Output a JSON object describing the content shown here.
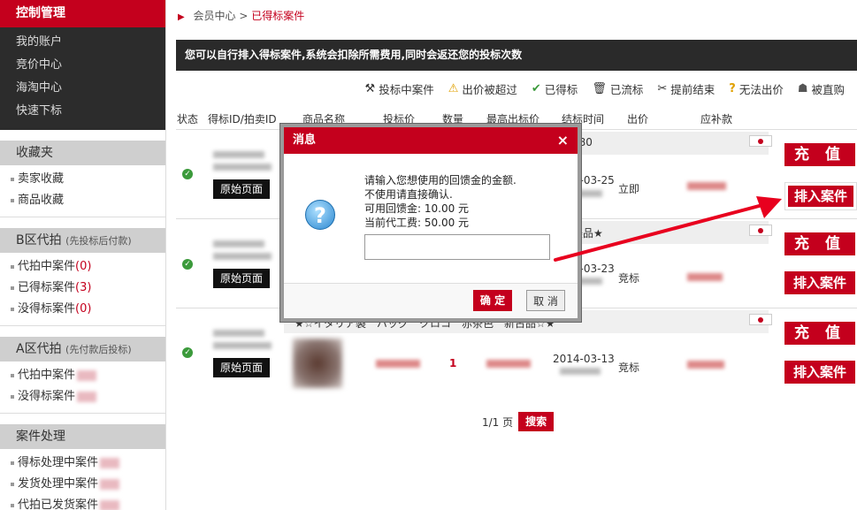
{
  "sidebar": {
    "control_title": "控制管理",
    "control_items": [
      "我的账户",
      "竞价中心",
      "海淘中心",
      "快速下标"
    ],
    "fav_title": "收藏夹",
    "fav_items": [
      "卖家收藏",
      "商品收藏"
    ],
    "b_title": "B区代拍",
    "b_sub": "(先投标后付款)",
    "b_items": [
      {
        "label": "代拍中案件",
        "count": "(0)"
      },
      {
        "label": "已得标案件",
        "count": "(3)"
      },
      {
        "label": "没得标案件",
        "count": "(0)"
      }
    ],
    "a_title": "A区代拍",
    "a_sub": "(先付款后投标)",
    "a_items": [
      "代拍中案件",
      "没得标案件"
    ],
    "case_title": "案件处理",
    "case_items": [
      "得标处理中案件",
      "发货处理中案件",
      "代拍已发货案件"
    ]
  },
  "breadcrumb": {
    "home": "会员中心",
    "sep": ">",
    "current": "已得标案件"
  },
  "notice": "您可以自行排入得标案件,系统会扣除所需费用,同时会返还您的投标次数",
  "filters": [
    {
      "icon": "hammer-icon",
      "glyph": "⚒",
      "label": "投标中案件"
    },
    {
      "icon": "warning-icon",
      "glyph": "⚠",
      "label": "出价被超过"
    },
    {
      "icon": "check-circle-icon",
      "glyph": "✔",
      "label": "已得标"
    },
    {
      "icon": "trash-icon",
      "glyph": "🗑",
      "label": "已流标"
    },
    {
      "icon": "scissors-icon",
      "glyph": "✂",
      "label": "提前结束"
    },
    {
      "icon": "question-icon",
      "glyph": "?",
      "label": "无法出价"
    },
    {
      "icon": "buyout-icon",
      "glyph": "☗",
      "label": "被直购"
    }
  ],
  "columns": [
    "状态",
    "得标ID/拍卖ID",
    "商品名称",
    "投标价",
    "数量",
    "最高出标价",
    "结标时间",
    "出价",
    "应补款"
  ],
  "rows": [
    {
      "orig_label": "原始页面",
      "date": "2014-03-25",
      "bid_type": "立即",
      "head_frag": "080",
      "charge": "充 值",
      "queue": "排入案件"
    },
    {
      "orig_label": "原始页面",
      "date": "2014-03-23",
      "bid_type": "竞标",
      "head_frag": "美品★",
      "charge": "充 值",
      "queue": "排入案件"
    },
    {
      "orig_label": "原始页面",
      "date": "2014-03-13",
      "bid_type": "竞标",
      "qty": "1",
      "title": "★☆イタリア製　バッグ　クロコ　赤茶色　新古品☆★",
      "charge": "充 值",
      "queue": "排入案件"
    }
  ],
  "pager": {
    "text": "1/1 页",
    "search": "搜索"
  },
  "modal": {
    "title": "消息",
    "close": "×",
    "lines": [
      "请输入您想使用的回馈金的金额.",
      "不使用请直接确认.",
      "可用回馈金: 10.00 元",
      "当前代工费: 50.00 元"
    ],
    "ok": "确 定",
    "cancel": "取 消"
  },
  "colors": {
    "brand_red": "#c4001d",
    "dark": "#2a2a2a",
    "status_green": "#3b9a3b"
  }
}
